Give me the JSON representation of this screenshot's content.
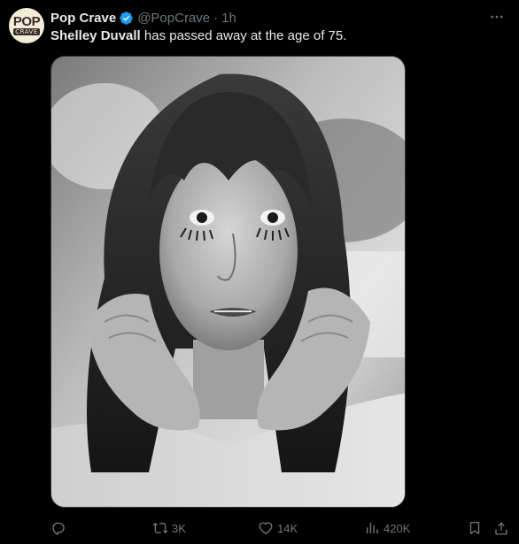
{
  "tweet": {
    "author": {
      "display_name": "Pop Crave",
      "handle": "@PopCrave",
      "avatar_text_top": "POP",
      "avatar_text_bottom": "CRAVE",
      "verified": true
    },
    "separator": "·",
    "time": "1h",
    "text_bold": "Shelley Duvall",
    "text_rest": " has passed away at the age of 75.",
    "media": {
      "kind": "photo",
      "style": "black-and-white portrait"
    },
    "actions": {
      "reply": {
        "icon": "reply-icon",
        "count": ""
      },
      "repost": {
        "icon": "repost-icon",
        "count": "3K"
      },
      "like": {
        "icon": "heart-icon",
        "count": "14K"
      },
      "views": {
        "icon": "views-icon",
        "count": "420K"
      },
      "bookmark": {
        "icon": "bookmark-icon"
      },
      "share": {
        "icon": "share-icon"
      }
    }
  },
  "colors": {
    "background": "#000000",
    "text": "#e7e9ea",
    "muted": "#71767b",
    "verified_badge": "#1d9bf0",
    "avatar_bg": "#f3ecd7",
    "avatar_ink": "#3a2b2b"
  }
}
